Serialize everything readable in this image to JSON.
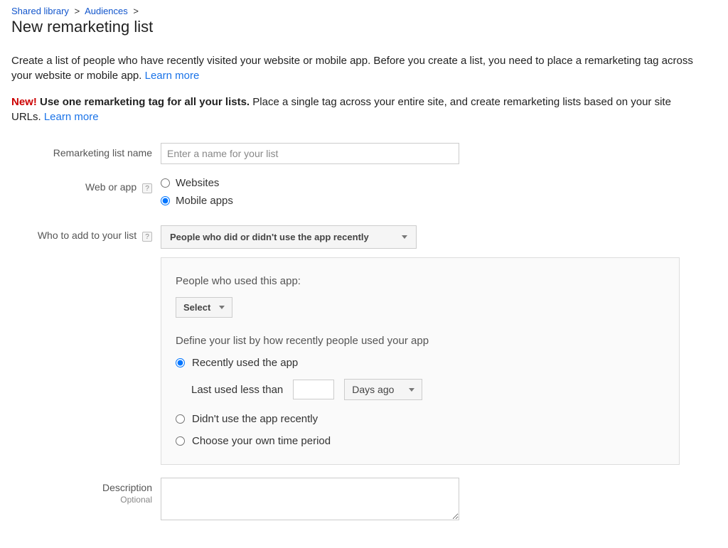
{
  "breadcrumb": {
    "item1": "Shared library",
    "item2": "Audiences"
  },
  "page_title": "New remarketing list",
  "intro": {
    "line1": "Create a list of people who have recently visited your website or mobile app. Before you create a list, you need to place a remarketing tag across your website or mobile app. ",
    "learn_more": "Learn more"
  },
  "tip": {
    "new_label": "New!",
    "bold_text": " Use one remarketing tag for all your lists.",
    "rest": " Place a single tag across your entire site, and create remarketing lists based on your site URLs. ",
    "learn_more": "Learn more"
  },
  "form": {
    "list_name": {
      "label": "Remarketing list name",
      "placeholder": "Enter a name for your list",
      "value": ""
    },
    "web_or_app": {
      "label": "Web or app",
      "options": {
        "websites": "Websites",
        "mobile_apps": "Mobile apps"
      },
      "selected": "mobile_apps"
    },
    "who_to_add": {
      "label": "Who to add to your list",
      "dropdown_selected": "People who did or didn't use the app recently"
    },
    "panel": {
      "people_used_label": "People who used this app:",
      "select_btn": "Select",
      "recency_label": "Define your list by how recently people used your app",
      "options": {
        "recent": "Recently used the app",
        "not_recent": "Didn't use the app recently",
        "own": "Choose your own time period"
      },
      "recent_indent": {
        "label": "Last used less than",
        "value": "",
        "unit_dropdown": "Days ago"
      },
      "selected": "recent"
    },
    "description": {
      "label": "Description",
      "sub": "Optional",
      "value": ""
    }
  }
}
